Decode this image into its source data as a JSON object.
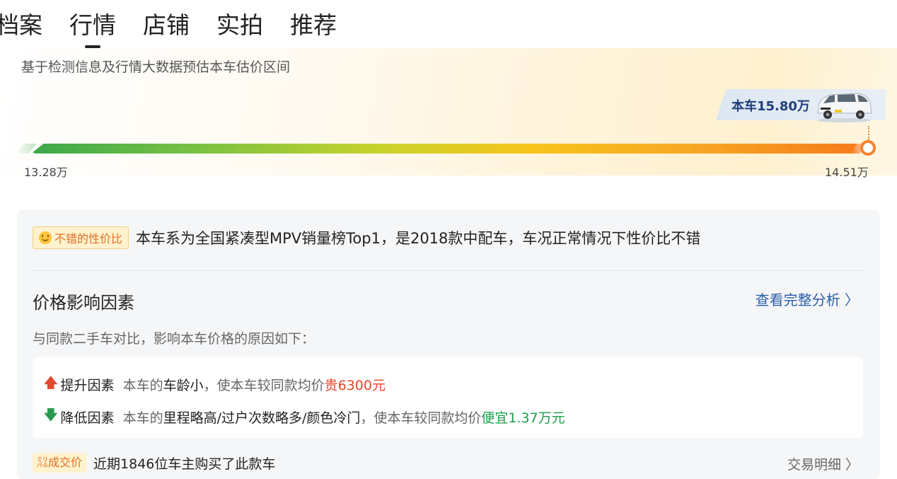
{
  "tabs": [
    {
      "label": "档案"
    },
    {
      "label": "行情",
      "active": true
    },
    {
      "label": "店铺"
    },
    {
      "label": "实拍"
    },
    {
      "label": "推荐"
    }
  ],
  "estimate": {
    "subtitle": "基于检测信息及行情大数据预估本车估价区间",
    "this_car_price": "本车15.80万",
    "range_min": "13.28万",
    "range_max": "14.51万"
  },
  "value_badge": {
    "label": "不错的性价比",
    "text": "本车系为全国紧凑型MPV销量榜Top1，是2018款中配车，车况正常情况下性价比不错"
  },
  "factors": {
    "title": "价格影响因素",
    "link": "查看完整分析 〉",
    "compare_text": "与同款二手车对比，影响本车价格的原因如下：",
    "increase": {
      "arrow": "🡅",
      "name": "提升因素",
      "prefix": "本车的",
      "key": "车龄小",
      "mid": "，使本车较同款均价",
      "effect": "贵6300元"
    },
    "decrease": {
      "arrow": "🡇",
      "name": "降低因素",
      "prefix": "本车的",
      "key": "里程略高/过户次数略多/颜色冷门",
      "mid": "，使本车较同款均价",
      "effect": "便宜1.37万元"
    }
  },
  "deal": {
    "badge": "㍊成交价",
    "text": "近期1846位车主购买了此款车",
    "link": "交易明细 〉"
  },
  "colors": {
    "accent_orange": "#f5822c",
    "link_blue": "#2a5ea8",
    "up_red": "#e8452c",
    "down_green": "#19a04a"
  }
}
